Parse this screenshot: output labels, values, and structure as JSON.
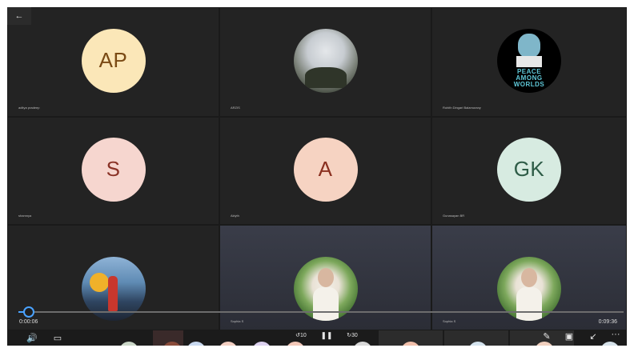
{
  "app": {
    "back_label": "←"
  },
  "participants": [
    {
      "name": "aditya pradeep",
      "initials": "AP",
      "avatar": "initials",
      "color": "#fbe7b8"
    },
    {
      "name": "ARZIS",
      "initials": "",
      "avatar": "misty-mountain-photo"
    },
    {
      "name": "Rohith Dingari Balamurany",
      "initials": "",
      "avatar": "rick-peace-among-worlds"
    },
    {
      "name": "shamnya",
      "initials": "S",
      "avatar": "initials",
      "color": "#f6d6cf"
    },
    {
      "name": "Akiyth",
      "initials": "A",
      "avatar": "initials",
      "color": "#f6d3c2"
    },
    {
      "name": "Gunasayan BR",
      "initials": "GK",
      "avatar": "initials",
      "color": "#d7ebe1"
    },
    {
      "name": "",
      "initials": "",
      "avatar": "person-in-city-photo"
    },
    {
      "name": "Sophia S",
      "initials": "",
      "avatar": "woman-in-garden-photo"
    },
    {
      "name": "Sophia S",
      "initials": "",
      "avatar": "woman-in-garden-photo"
    }
  ],
  "rick_art_text": "PEACE AMONG WORLDS",
  "playback": {
    "elapsed": "0:00:06",
    "total": "0:09:36",
    "progress_fraction": 0.011
  },
  "controls": {
    "volume_icon": "🔊",
    "captions_icon": "▭",
    "rewind_label": "10",
    "pause_icon": "❚❚",
    "forward_label": "30",
    "pen_icon": "✎",
    "pip_icon": "▣",
    "minimize_icon": "↙",
    "more_icon": "···"
  },
  "strip_chips": [
    {
      "initials": "AU",
      "color": "#cbd7c8"
    },
    {
      "initials": "NS",
      "color": "#c9d9f0"
    },
    {
      "initials": "TA",
      "color": "#f3cfc2"
    },
    {
      "initials": "RR",
      "color": "#ddd2f0"
    },
    {
      "initials": "AM",
      "color": "#f3c8b8"
    },
    {
      "initials": "JS",
      "color": "#d8d8d8"
    },
    {
      "initials": "AR",
      "color": "#f2c0ab"
    },
    {
      "initials": "VA",
      "color": "#d4e3ee"
    },
    {
      "initials": "SC",
      "color": "#f1d0bf"
    },
    {
      "initials": "DS",
      "color": "#d6e2ea"
    }
  ]
}
